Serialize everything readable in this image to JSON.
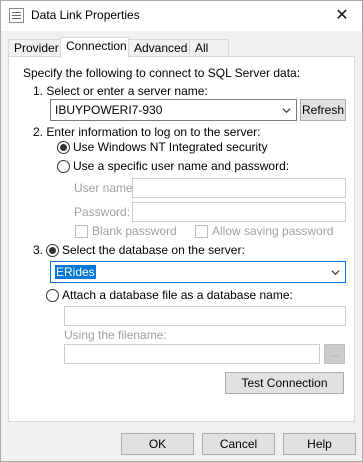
{
  "window": {
    "title": "Data Link Properties"
  },
  "tabs": [
    {
      "label": "Provider"
    },
    {
      "label": "Connection"
    },
    {
      "label": "Advanced"
    },
    {
      "label": "All"
    }
  ],
  "connection": {
    "intro": "Specify the following to connect to SQL Server data:",
    "step1_label": "1. Select or enter a server name:",
    "server_value": "IBUYPOWERI7-930",
    "refresh_label": "Refresh",
    "step2_label": "2. Enter information to log on to the server:",
    "windows_auth_label": "Use Windows NT Integrated security",
    "specific_user_label": "Use a specific user name and password:",
    "username_label": "User name:",
    "password_label": "Password:",
    "blank_password_label": "Blank password",
    "allow_saving_label": "Allow saving password",
    "step3_number": "3.",
    "select_db_label": "Select the database on the server:",
    "database_value": "ERides",
    "attach_label": "Attach a database file as a database name:",
    "filename_label": "Using the filename:",
    "browse_label": "...",
    "test_label": "Test Connection"
  },
  "footer": {
    "ok_label": "OK",
    "cancel_label": "Cancel",
    "help_label": "Help"
  }
}
